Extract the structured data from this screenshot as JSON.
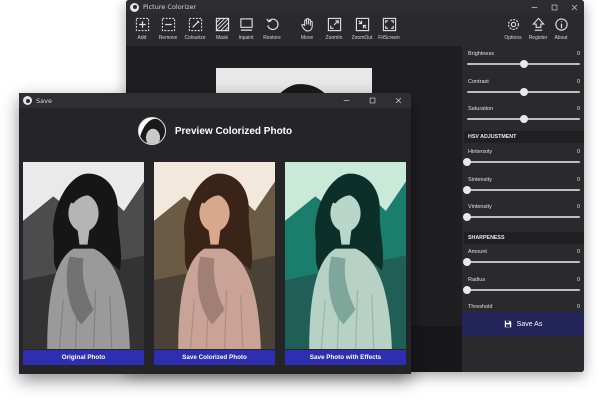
{
  "main_window": {
    "title": "Picture Colorizer",
    "toolbar": {
      "add": "Add",
      "remove": "Remove",
      "colourize": "Colourize",
      "mask": "Mask",
      "inpaint": "Inpaint",
      "restore": "Restore",
      "move": "Move",
      "zoom_in": "ZoomIn",
      "zoom_out": "ZoomOut",
      "fit_screen": "FitScreen",
      "options": "Options",
      "register": "Register",
      "about": "About"
    },
    "adjustments": [
      {
        "label": "Brightness",
        "value": "0",
        "level": 0.5
      },
      {
        "label": "Contrast",
        "value": "0",
        "level": 0.5
      },
      {
        "label": "Saturation",
        "value": "0",
        "level": 0.5
      }
    ],
    "hsv_section": "HSV ADJUSTMENT",
    "hsv": [
      {
        "label": "Hintensity",
        "value": "0",
        "level": 0
      },
      {
        "label": "Sintensity",
        "value": "0",
        "level": 0
      },
      {
        "label": "Vintensity",
        "value": "0",
        "level": 0
      }
    ],
    "sharpness_section": "SHARPENESS",
    "sharpness": [
      {
        "label": "Amount",
        "value": "0",
        "level": 0
      },
      {
        "label": "Radius",
        "value": "0",
        "level": 0
      },
      {
        "label": "Threshold",
        "value": "0",
        "level": 0
      }
    ],
    "save_as_label": "Save As"
  },
  "save_dialog": {
    "title": "Save",
    "heading": "Preview Colorized Photo",
    "buttons": {
      "original": "Original Photo",
      "colorized": "Save Colorized Photo",
      "effects": "Save Photo with Effects"
    }
  },
  "colors": {
    "accent_button": "#2e2eb0",
    "save_as_bg": "#232458",
    "window_bg": "#252528"
  }
}
